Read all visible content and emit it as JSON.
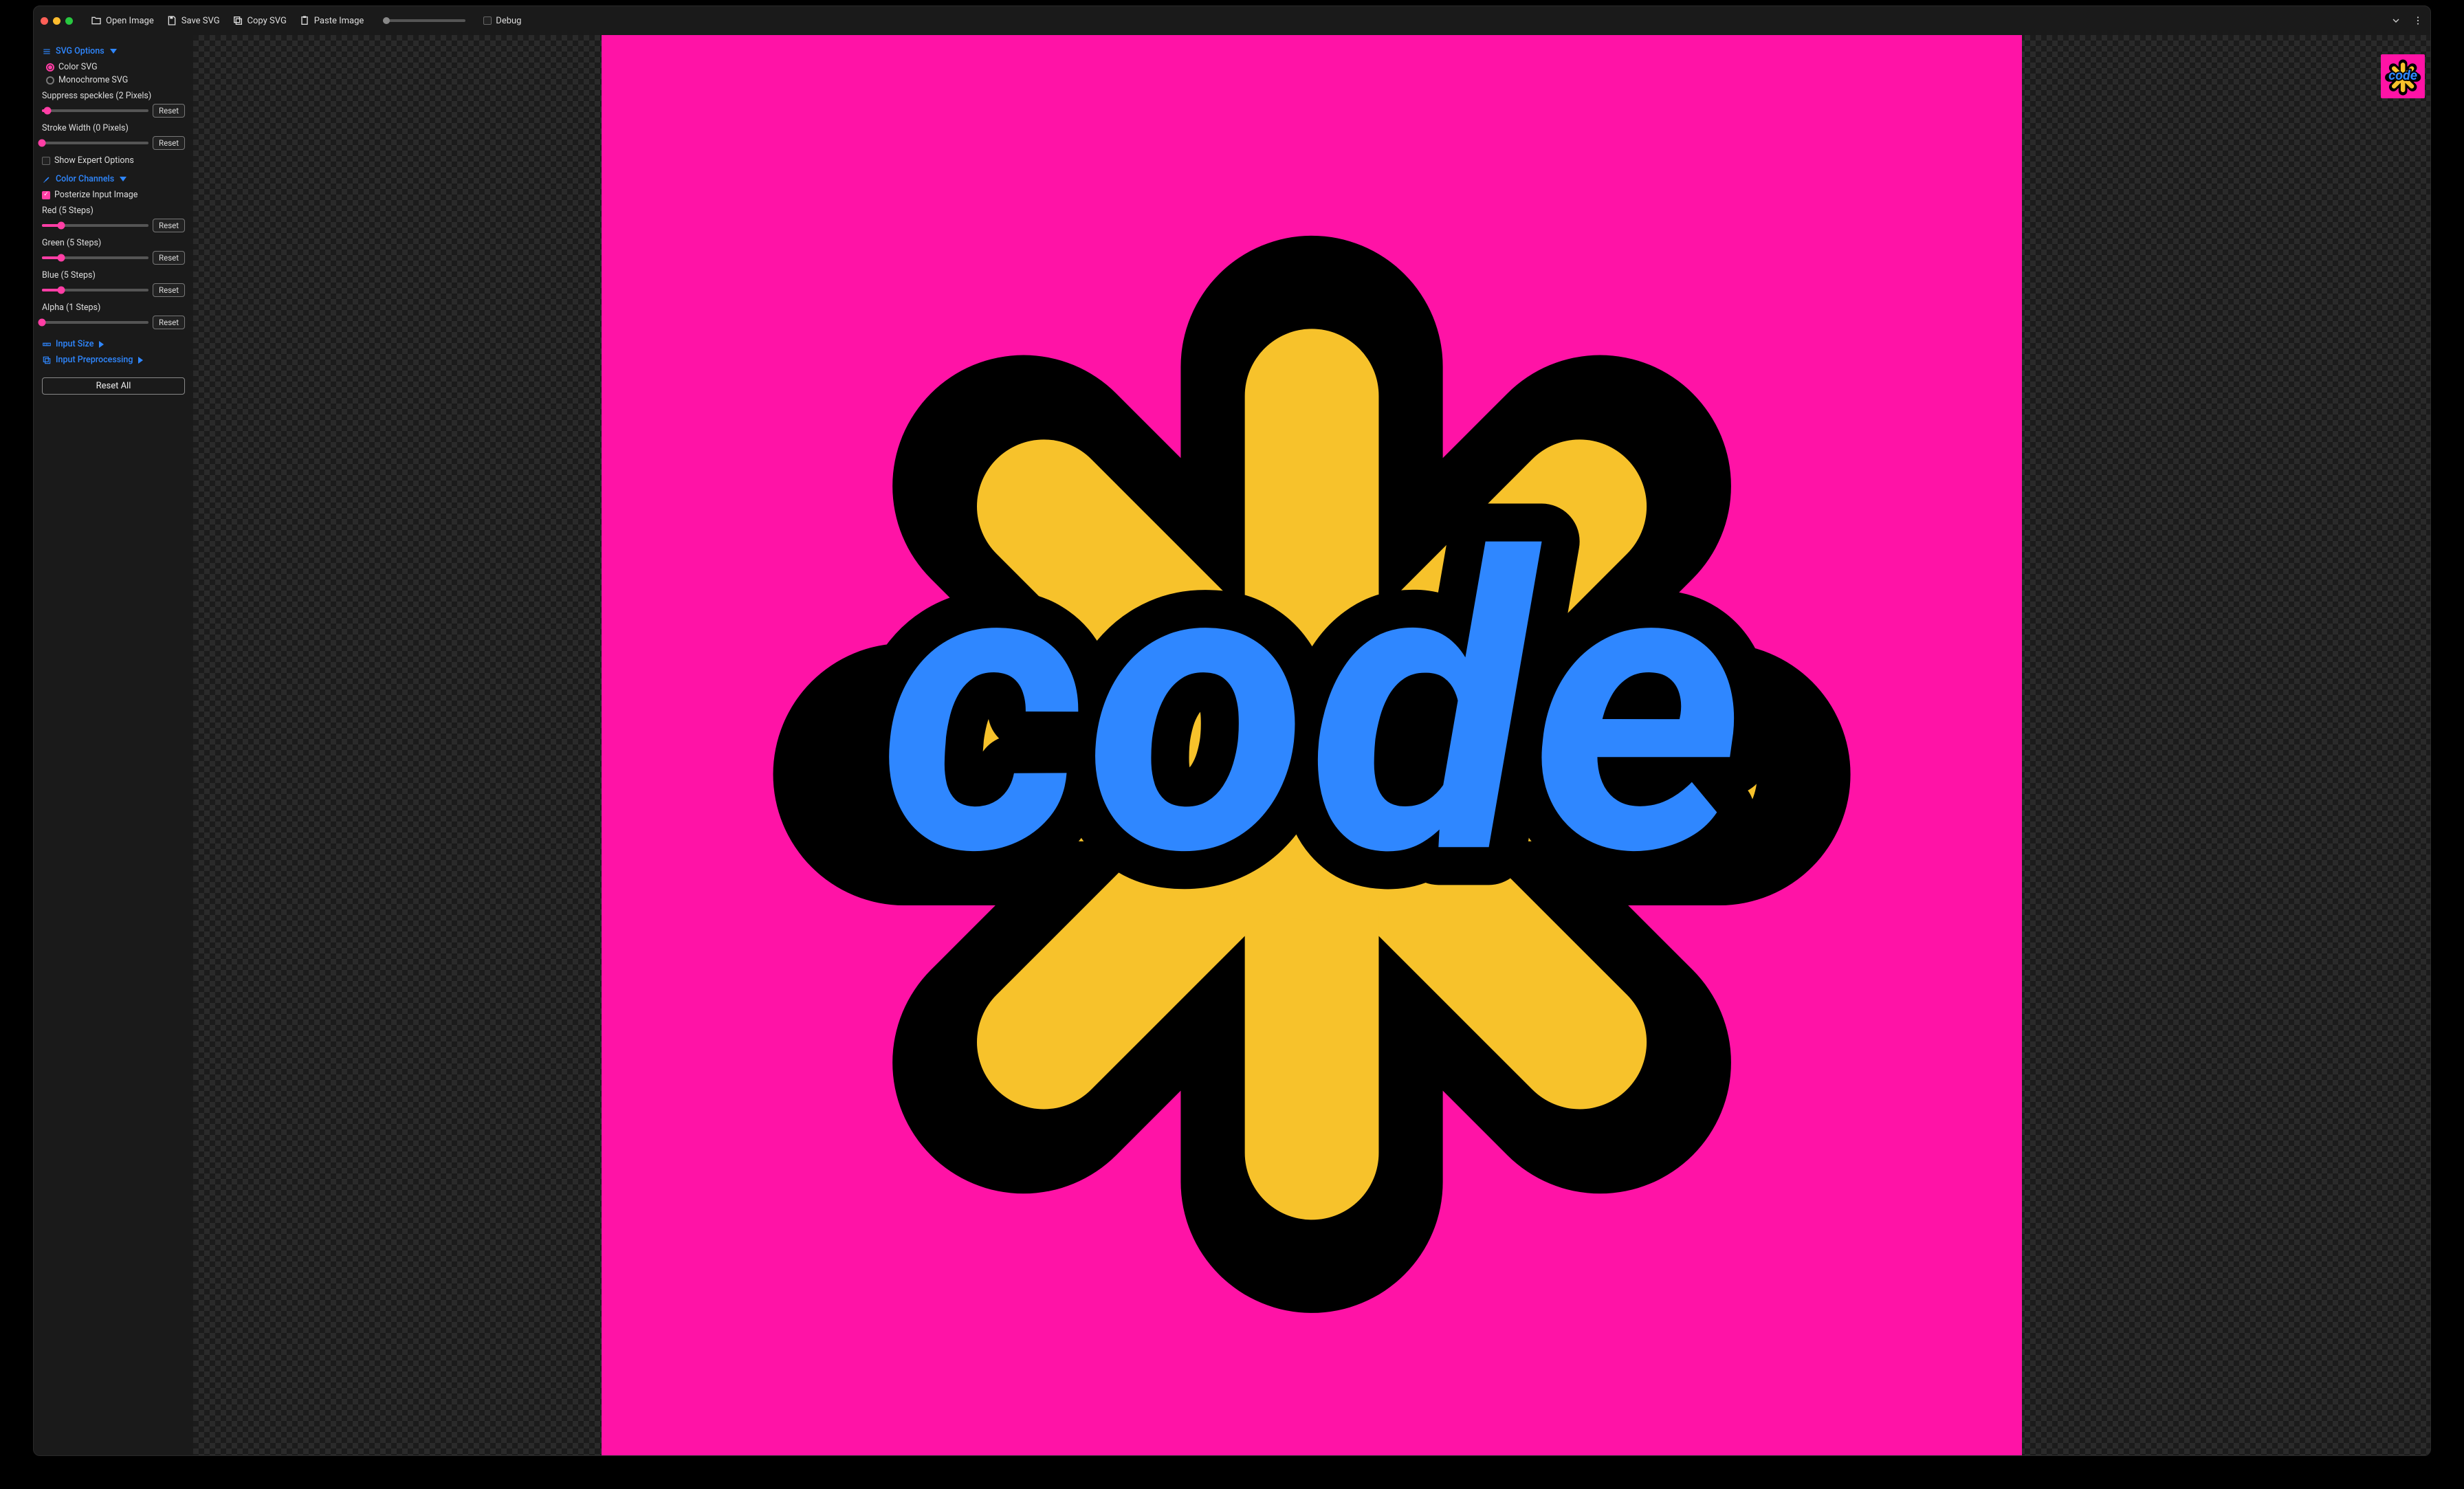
{
  "toolbar": {
    "open_label": "Open Image",
    "save_label": "Save SVG",
    "copy_label": "Copy SVG",
    "paste_label": "Paste Image",
    "debug_label": "Debug"
  },
  "sidebar": {
    "svg_options": {
      "title": "SVG Options",
      "color_svg_label": "Color SVG",
      "mono_svg_label": "Monochrome SVG",
      "selected": "color",
      "suppress_label": "Suppress speckles (2 Pixels)",
      "suppress_value_pct": 5,
      "stroke_label": "Stroke Width (0 Pixels)",
      "stroke_value_pct": 0,
      "expert_label": "Show Expert Options",
      "expert_checked": false,
      "reset_label": "Reset"
    },
    "color_channels": {
      "title": "Color Channels",
      "posterize_label": "Posterize Input Image",
      "posterize_checked": true,
      "red_label": "Red (5 Steps)",
      "red_value_pct": 18,
      "green_label": "Green (5 Steps)",
      "green_value_pct": 18,
      "blue_label": "Blue (5 Steps)",
      "blue_value_pct": 18,
      "alpha_label": "Alpha (1 Steps)",
      "alpha_value_pct": 0,
      "reset_label": "Reset"
    },
    "input_size_title": "Input Size",
    "input_preproc_title": "Input Preprocessing",
    "reset_all_label": "Reset All"
  },
  "artwork": {
    "bg_color": "#ff13a6",
    "outline_color": "#000000",
    "burst_color": "#f7c22b",
    "text_color": "#2f87ff",
    "word": "code"
  }
}
